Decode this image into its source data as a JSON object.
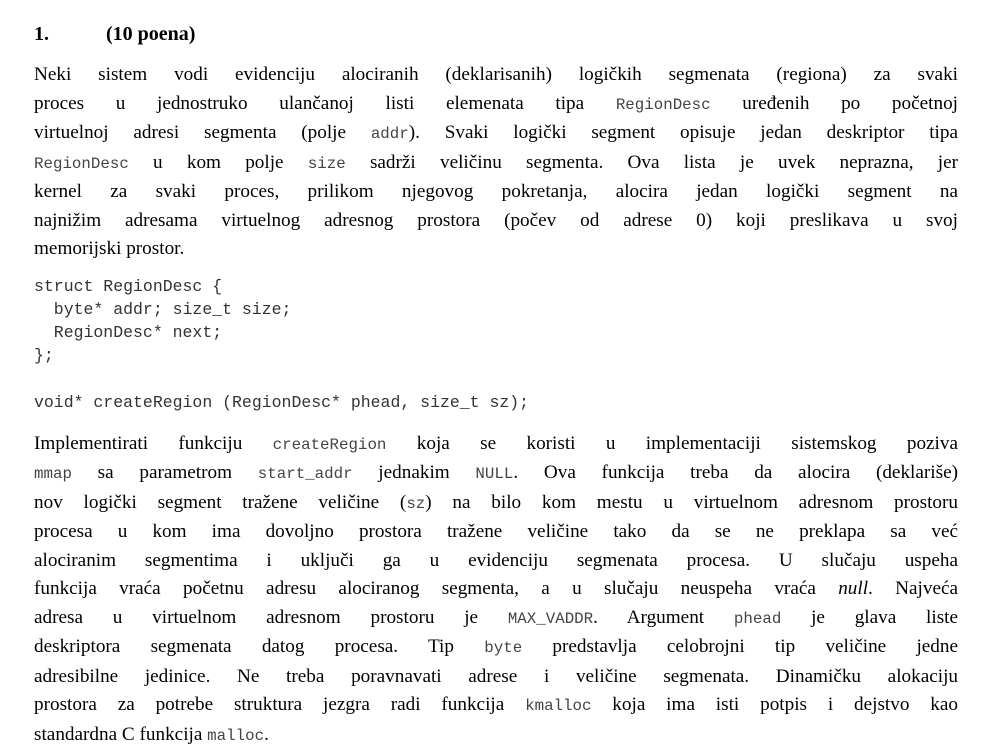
{
  "task": {
    "number": "1.",
    "points": "(10 poena)"
  },
  "intro": {
    "l1": "Neki sistem vodi evidenciju alociranih (deklarisanih) logičkih segmenata (regiona) za svaki",
    "l2a": "proces u jednostruko ulančanoj listi elemenata tipa ",
    "l2code": "RegionDesc",
    "l2b": " uređenih po početnoj",
    "l3a": "virtuelnoj adresi segmenta (polje ",
    "l3code": "addr",
    "l3b": "). Svaki logički segment opisuje jedan deskriptor tipa",
    "l4code1": "RegionDesc",
    "l4a": " u kom polje ",
    "l4code2": "size",
    "l4b": " sadrži veličinu segmenta. Ova lista je uvek neprazna, jer",
    "l5": "kernel za svaki proces, prilikom njegovog pokretanja, alocira jedan logički segment na",
    "l6": "najnižim adresama virtuelnog adresnog prostora (počev od adrese 0) koji preslikava u svoj",
    "l7": "memorijski prostor."
  },
  "code": {
    "struct": "struct RegionDesc {\n  byte* addr; size_t size;\n  RegionDesc* next;\n};",
    "signature": "void* createRegion (RegionDesc* phead, size_t sz);"
  },
  "body": {
    "l1a": "Implementirati funkciju ",
    "l1code": "createRegion",
    "l1b": " koja se koristi u implementaciji sistemskog poziva",
    "l2code1": "mmap",
    "l2a": " sa parametrom ",
    "l2code2": "start_addr",
    "l2b": " jednakim ",
    "l2code3": "NULL",
    "l2c": ". Ova funkcija treba da alocira (deklariše)",
    "l3a": "nov logički segment tražene veličine (",
    "l3code": "sz",
    "l3b": ") na bilo kom mestu u virtuelnom adresnom prostoru",
    "l4": "procesa u kom ima dovoljno prostora tražene veličine tako da se ne preklapa sa već",
    "l5": "alociranim segmentima i uključi ga u evidenciju segmenata procesa. U slučaju uspeha",
    "l6a": "funkcija vraća početnu adresu alociranog segmenta, a u slučaju neuspeha vraća ",
    "l6em": "null",
    "l6b": ". Najveća",
    "l7a": "adresa u virtuelnom adresnom prostoru je ",
    "l7code": "MAX_VADDR",
    "l7b": ". Argument ",
    "l7code2": "phead",
    "l7c": " je glava liste",
    "l8a": "deskriptora segmenata datog procesa. Tip ",
    "l8code": "byte",
    "l8b": " predstavlja celobrojni tip veličine jedne",
    "l9": "adresibilne jedinice. Ne treba poravnavati adrese i veličine segmenata. Dinamičku alokaciju",
    "l10a": "prostora za potrebe struktura jezgra radi funkcija ",
    "l10code": "kmalloc",
    "l10b": " koja ima isti potpis i dejstvo kao",
    "l11a": "standardna C funkcija ",
    "l11code": "malloc",
    "l11b": "."
  }
}
